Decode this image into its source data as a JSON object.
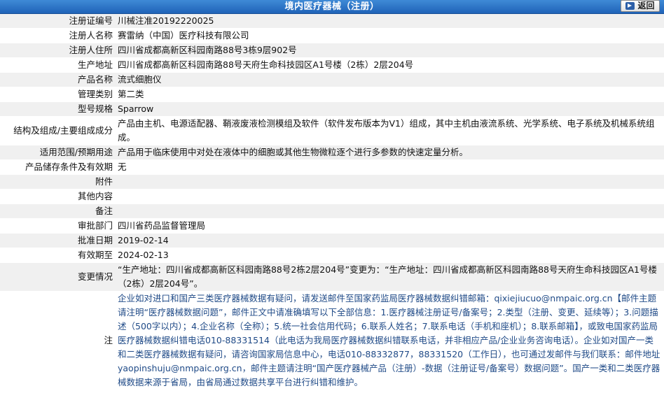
{
  "header": {
    "title": "境内医疗器械（注册）",
    "back_label": "返回"
  },
  "rows": [
    {
      "label": "注册证编号",
      "value": "川械注准20192220025"
    },
    {
      "label": "注册人名称",
      "value": "赛雷纳（中国）医疗科技有限公司"
    },
    {
      "label": "注册人住所",
      "value": "四川省成都高新区科园南路88号3栋9层902号"
    },
    {
      "label": "生产地址",
      "value": "四川省成都高新区科园南路88号天府生命科技园区A1号楼（2栋）2层204号"
    },
    {
      "label": "产品名称",
      "value": "流式细胞仪"
    },
    {
      "label": "管理类别",
      "value": "第二类"
    },
    {
      "label": "型号规格",
      "value": "Sparrow"
    },
    {
      "label": "结构及组成/主要组成成分",
      "value": "产品由主机、电源适配器、鞘液废液检测模组及软件（软件发布版本为V1）组成，其中主机由液流系统、光学系统、电子系统及机械系统组成。"
    },
    {
      "label": "适用范围/预期用途",
      "value": "产品用于临床使用中对处在液体中的细胞或其他生物微粒逐个进行多参数的快速定量分析。"
    },
    {
      "label": "产品储存条件及有效期",
      "value": "无"
    },
    {
      "label": "附件",
      "value": ""
    },
    {
      "label": "其他内容",
      "value": ""
    },
    {
      "label": "备注",
      "value": ""
    },
    {
      "label": "审批部门",
      "value": "四川省药品监督管理局"
    },
    {
      "label": "批准日期",
      "value": "2019-02-14"
    },
    {
      "label": "有效期至",
      "value": "2024-02-13"
    },
    {
      "label": "变更情况",
      "value": "“生产地址：四川省成都高新区科园南路88号2栋2层204号”变更为：“生产地址：四川省成都高新区科园南路88号天府生命科技园区A1号楼（2栋）2层204号”。"
    }
  ],
  "note": {
    "label": "注",
    "text": "企业如对进口和国产三类医疗器械数据有疑问，请发送邮件至国家药监局医疗器械数据纠错邮箱：qixiejiucuo@nmpaic.org.cn【邮件主题请注明“医疗器械数据问题”，邮件正文中请准确填写以下全部信息：1.医疗器械注册证号/备案号；2.类型（注册、变更、延续等）；3.问题描述（500字以内）；4.企业名称（全称）；5.统一社会信用代码；6.联系人姓名；7.联系电话（手机和座机）；8.联系邮箱】，或致电国家药监局医疗器械数据纠错电话010-88331514（此电话为我局医疗器械数据纠错联系电话，并非相应产品/企业业务咨询电话）。企业如对国产一类和二类医疗器械数据有疑问，请咨询国家局信息中心，电话010-88332877，88331520（工作日），也可通过发邮件与我们联系：邮件地址yaopinshuju@nmpaic.org.cn，邮件主题请注明“国产医疗器械产品（注册）-数据（注册证号/备案号）数据问题”。国产一类和二类医疗器械数据来源于省局，由省局通过数据共享平台进行纠错和维护。"
  },
  "colors": {
    "header_bg": "#2a6fc4",
    "row_alt_bg": "#f0f0f0",
    "note_text": "#1f4a87"
  },
  "icons": {
    "back": "back-arrow-icon"
  }
}
